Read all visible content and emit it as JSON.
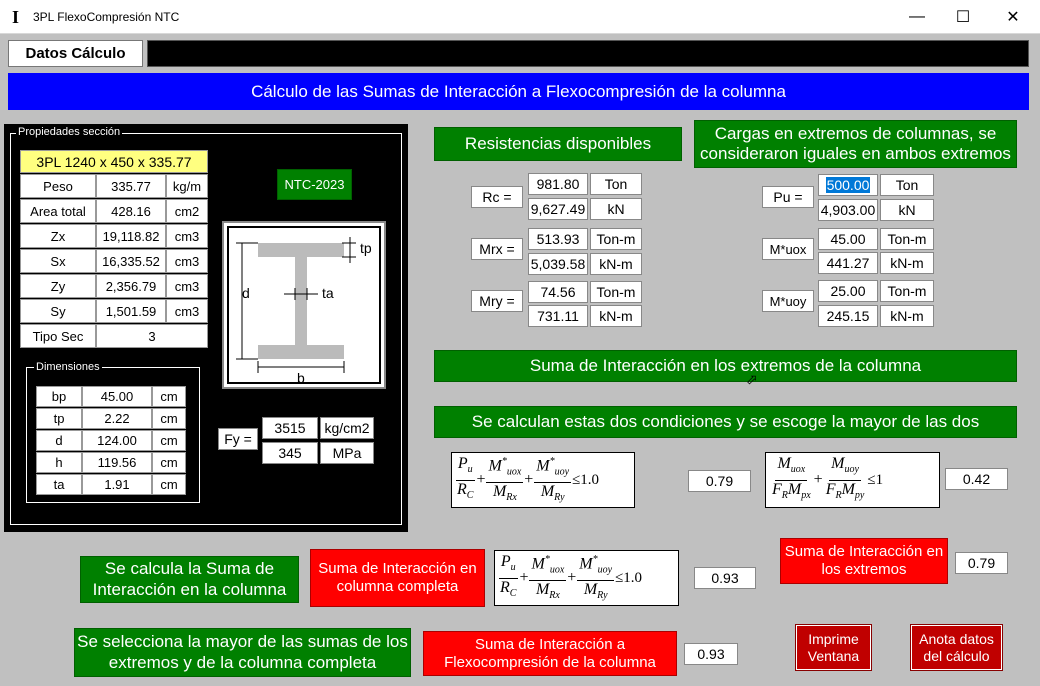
{
  "window": {
    "title": "3PL FlexoCompresión NTC",
    "icon": "I"
  },
  "tab": {
    "label": "Datos Cálculo"
  },
  "banner": {
    "text": "Cálculo de las Sumas de Interacción a Flexocompresión de la columna"
  },
  "props": {
    "legend": "Propiedades sección",
    "section_name": "3PL 1240 x 450 x 335.77",
    "rows": [
      {
        "label": "Peso",
        "value": "335.77",
        "unit": "kg/m"
      },
      {
        "label": "Area total",
        "value": "428.16",
        "unit": "cm2"
      },
      {
        "label": "Zx",
        "value": "19,118.82",
        "unit": "cm3"
      },
      {
        "label": "Sx",
        "value": "16,335.52",
        "unit": "cm3"
      },
      {
        "label": "Zy",
        "value": "2,356.79",
        "unit": "cm3"
      },
      {
        "label": "Sy",
        "value": "1,501.59",
        "unit": "cm3"
      }
    ],
    "tipo_label": "Tipo Sec",
    "tipo_value": "3",
    "norm": "NTC-2023",
    "dims_legend": "Dimensiones",
    "dims": [
      {
        "label": "bp",
        "value": "45.00",
        "unit": "cm"
      },
      {
        "label": "tp",
        "value": "2.22",
        "unit": "cm"
      },
      {
        "label": "d",
        "value": "124.00",
        "unit": "cm"
      },
      {
        "label": "h",
        "value": "119.56",
        "unit": "cm"
      },
      {
        "label": "ta",
        "value": "1.91",
        "unit": "cm"
      }
    ],
    "fy_label": "Fy =",
    "fy_kg": "3515",
    "fy_kg_unit": "kg/cm2",
    "fy_mpa": "345",
    "fy_mpa_unit": "MPa",
    "diagram": {
      "tp": "tp",
      "d": "d",
      "ta": "ta",
      "b": "b"
    }
  },
  "resist": {
    "title": "Resistencias disponibles",
    "rc_label": "Rc =",
    "rc_ton": "981.80",
    "rc_ton_unit": "Ton",
    "rc_kn": "9,627.49",
    "rc_kn_unit": "kN",
    "mrx_label": "Mrx =",
    "mrx_tm": "513.93",
    "mrx_tm_unit": "Ton-m",
    "mrx_knm": "5,039.58",
    "mrx_knm_unit": "kN-m",
    "mry_label": "Mry =",
    "mry_tm": "74.56",
    "mry_tm_unit": "Ton-m",
    "mry_knm": "731.11",
    "mry_knm_unit": "kN-m"
  },
  "loads": {
    "title": "Cargas en extremos de columnas, se consideraron iguales en ambos extremos",
    "pu_label": "Pu =",
    "pu_ton": "500.00",
    "pu_ton_unit": "Ton",
    "pu_kn": "4,903.00",
    "pu_kn_unit": "kN",
    "mux_label": "M*uox",
    "mux_tm": "45.00",
    "mux_tm_unit": "Ton-m",
    "mux_knm": "441.27",
    "mux_knm_unit": "kN-m",
    "muy_label": "M*uoy",
    "muy_tm": "25.00",
    "muy_tm_unit": "Ton-m",
    "muy_knm": "245.15",
    "muy_knm_unit": "kN-m"
  },
  "ends": {
    "title": "Suma de Interacción en los extremos de la columna",
    "subtitle": "Se  calculan estas dos condiciones y se escoge la mayor de las dos",
    "value1": "0.79",
    "value2": "0.42"
  },
  "column": {
    "label": "Se calcula la Suma de Interacción en la columna",
    "red_label": "Suma de Interacción en columna completa",
    "value": "0.93",
    "ext_label": "Suma de Interacción en los extremos",
    "ext_value": "0.79"
  },
  "final": {
    "label": "Se  selecciona la mayor de las sumas de los extremos y de la columna completa",
    "red_label": "Suma de Interacción a Flexocompresión de la columna",
    "value": "0.93",
    "print_button": "Imprime Ventana",
    "notes_button": "Anota datos del cálculo"
  },
  "colors": {
    "green": "#008000",
    "red": "#ff0000",
    "blue": "#0000ff",
    "darkred": "#c00000",
    "bg": "#c0c0c0"
  }
}
